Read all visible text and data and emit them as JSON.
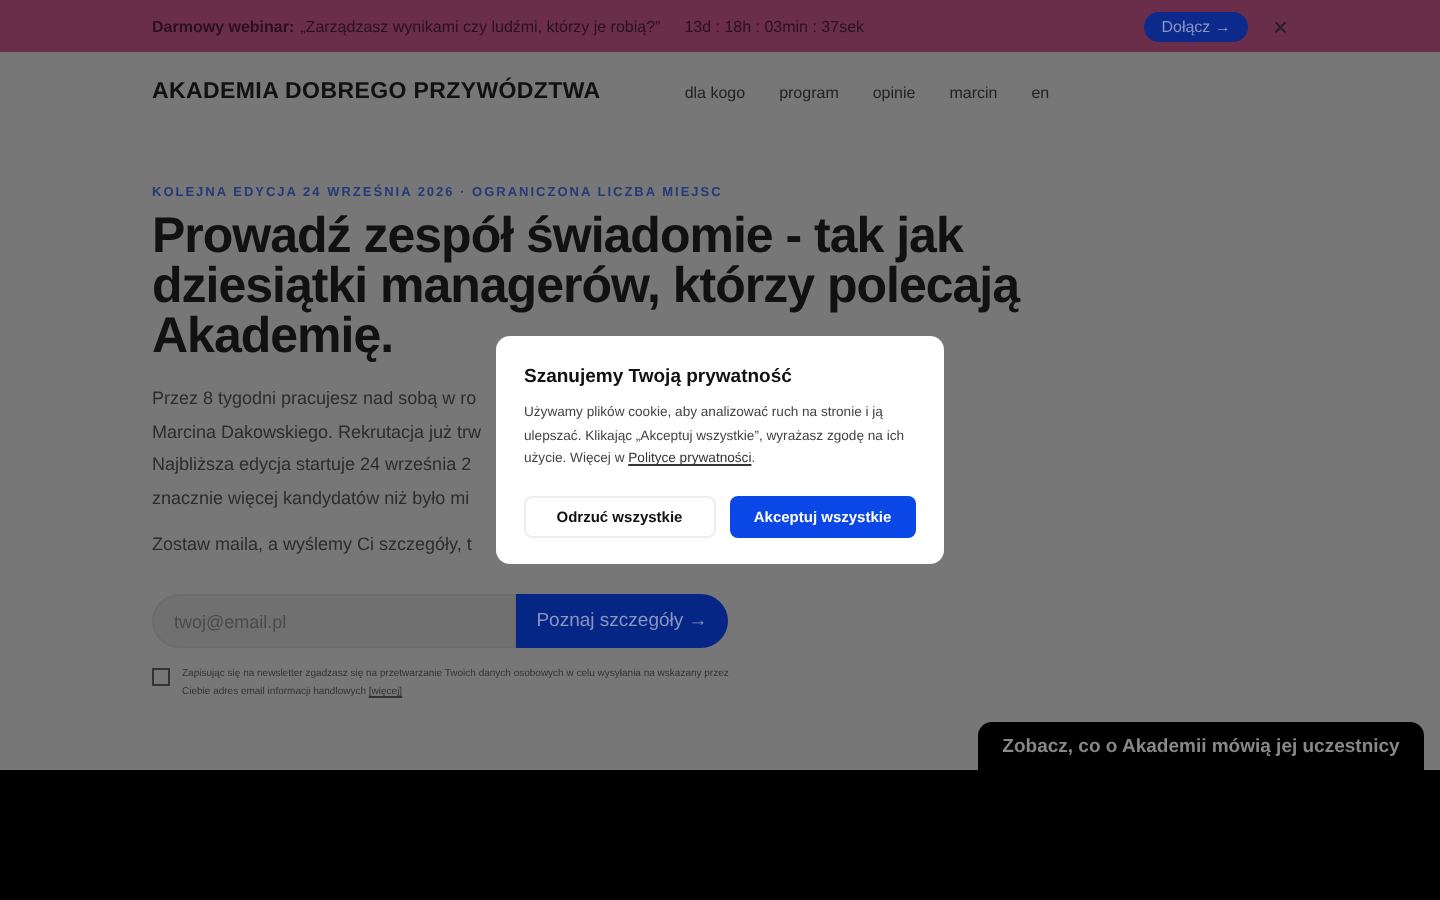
{
  "promo_bar": {
    "label": "Darmowy webinar:",
    "quote": "„Zarządzasz wynikami czy ludźmi, którzy je robią?”",
    "countdown": "13d : 18h : 03min : 37sek",
    "button": "Dołącz",
    "button_arrow": "→",
    "close": "×"
  },
  "header": {
    "logo": "AKADEMIA DOBREGO PRZYWÓDZTWA",
    "nav": [
      "dla kogo",
      "program",
      "opinie",
      "marcin",
      "en"
    ]
  },
  "hero": {
    "eyebrow": "KOLEJNA EDYCJA 24 WRZEŚNIA 2026 · OGRANICZONA LICZBA MIEJSC",
    "title": "Prowadź zespół świadomie - tak jak dziesiątki managerów, którzy polecają Akademię.",
    "paragraph_lines": [
      "Przez 8 tygodni pracujesz nad sobą w ro",
      "Marcina Dakowskiego. Rekrutacja już trw",
      "Najbliższa edycja startuje 24 września 2",
      "znacznie więcej kandydatów niż było mi"
    ],
    "cta_text": "Zostaw maila, a wyślemy Ci szczegóły, t",
    "email": {
      "placeholder": "twoj@email.pl"
    },
    "submit": "Poznaj szczegóły",
    "submit_arrow": "→",
    "consent": {
      "checked": false,
      "text": "Zapisując się na newsletter zgadzasz się na przetwarzanie Twoich danych osobowych w celu wysyłania na wskazany przez Ciebie adres email informacji handlowych",
      "link": "[więcej]"
    }
  },
  "cookie_dialog": {
    "title": "Szanujemy Twoją prywatność",
    "text": "Używamy plików cookie, aby analizować ruch na stronie i ją ulepszać. Klikając „Akceptuj wszystkie”, wyrażasz zgodę na ich użycie. Więcej w",
    "link": "Polityce prywatności",
    "text_end": ".",
    "buttons": [
      {
        "label": "Odrzuć wszystkie",
        "kind": "secondary"
      },
      {
        "label": "Akceptuj wszystkie",
        "kind": "primary"
      }
    ]
  },
  "testimonials_tab": "Zobacz, co o Akademii mówią jej uczestnicy"
}
